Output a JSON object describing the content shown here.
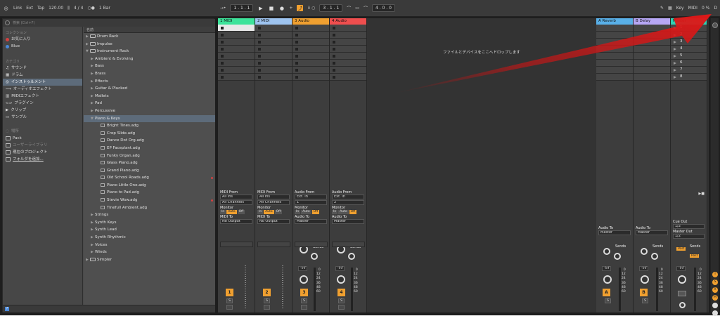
{
  "topbar": {
    "link": "Link",
    "ext": "Ext",
    "tap": "Tap",
    "tempo": "120.00",
    "meter": "4 / 4",
    "quant": "1 Bar",
    "pos1": "1 . 1 . 1",
    "pos2": "3 . 1 . 1",
    "pos3": "4 . 0 . 0",
    "key": "Key",
    "midi": "MIDI",
    "cpu": "0 %",
    "d": "D"
  },
  "browser": {
    "search_placeholder": "検索 (Ctrl+F)",
    "collections_header": "コレクション",
    "collections": [
      {
        "label": "お気に入り",
        "color": "#d24040"
      },
      {
        "label": "Blue",
        "color": "#4a88d8"
      }
    ],
    "category_header": "カテゴリ",
    "categories": [
      "サウンド",
      "ドラム",
      "インストゥルメント",
      "オーディオエフェクト",
      "MIDIエフェクト",
      "プラグイン",
      "クリップ",
      "サンプル"
    ],
    "places_header": "場所",
    "places": [
      "Pack",
      "ユーザーライブラリ",
      "現在のプロジェクト",
      "フォルダを追加..."
    ],
    "name_header": "名前",
    "items": [
      {
        "label": "Drum Rack",
        "kind": "folder-closed"
      },
      {
        "label": "Impulse",
        "kind": "folder-closed"
      },
      {
        "label": "Instrument Rack",
        "kind": "folder-open"
      },
      {
        "label": "Ambient & Evolving",
        "kind": "sub"
      },
      {
        "label": "Bass",
        "kind": "sub"
      },
      {
        "label": "Brass",
        "kind": "sub"
      },
      {
        "label": "Effects",
        "kind": "sub"
      },
      {
        "label": "Guitar & Plucked",
        "kind": "sub"
      },
      {
        "label": "Mallets",
        "kind": "sub"
      },
      {
        "label": "Pad",
        "kind": "sub"
      },
      {
        "label": "Percussive",
        "kind": "sub"
      },
      {
        "label": "Piano & Keys",
        "kind": "sub-open"
      },
      {
        "label": "Bright Tines.adg",
        "kind": "file"
      },
      {
        "label": "Crep Slide.adg",
        "kind": "file"
      },
      {
        "label": "Dance Dot Org.adg",
        "kind": "file"
      },
      {
        "label": "EP Faceplant.adg",
        "kind": "file"
      },
      {
        "label": "Funky Organ.adg",
        "kind": "file"
      },
      {
        "label": "Glass Piano.adg",
        "kind": "file"
      },
      {
        "label": "Grand Piano.adg",
        "kind": "file"
      },
      {
        "label": "Old School Roads.adg",
        "kind": "file",
        "fav": true
      },
      {
        "label": "Piano Little One.adg",
        "kind": "file"
      },
      {
        "label": "Piano to Pad.adg",
        "kind": "file"
      },
      {
        "label": "Stevie Wow.adg",
        "kind": "file",
        "fav": true
      },
      {
        "label": "Tinefull Ambient.adg",
        "kind": "file"
      },
      {
        "label": "Strings",
        "kind": "sub"
      },
      {
        "label": "Synth Keys",
        "kind": "sub"
      },
      {
        "label": "Synth Lead",
        "kind": "sub"
      },
      {
        "label": "Synth Rhythmic",
        "kind": "sub"
      },
      {
        "label": "Voices",
        "kind": "sub"
      },
      {
        "label": "Winds",
        "kind": "sub"
      },
      {
        "label": "Simpler",
        "kind": "folder-closed"
      }
    ]
  },
  "session": {
    "drop_message": "ファイルとデバイスをここへドロップします",
    "tracks": [
      {
        "name": "1 MIDI",
        "color": "#3de39a",
        "num": "1",
        "type": "midi"
      },
      {
        "name": "2 MIDI",
        "color": "#9ec4f0",
        "num": "2",
        "type": "midi"
      },
      {
        "name": "3 Audio",
        "color": "#f0a030",
        "num": "3",
        "type": "audio"
      },
      {
        "name": "4 Audio",
        "color": "#ef4e4e",
        "num": "4",
        "type": "audio"
      }
    ],
    "returns": [
      {
        "name": "A Reverb",
        "color": "#59b0e8",
        "letter": "A"
      },
      {
        "name": "B Delay",
        "color": "#b7a7f5",
        "letter": "B"
      }
    ],
    "master": {
      "name": "Master",
      "color": "#2fd2b4",
      "scenes": [
        "1",
        "2",
        "3",
        "4",
        "5",
        "6",
        "7",
        "8"
      ]
    },
    "io": {
      "midi_from": "MIDI From",
      "all_ins": "All Ins",
      "all_channels": "All Channels",
      "monitor": "Monitor",
      "in": "In",
      "auto": "Auto",
      "off": "Off",
      "midi_to": "MIDI To",
      "no_output": "No Output",
      "audio_from": "Audio From",
      "ext_in": "Ext. In",
      "ch1": "1",
      "ch2": "2",
      "audio_to": "Audio To",
      "master_out": "Master",
      "cue_out": "Cue Out",
      "cue_val": "1/2",
      "master_out_label": "Master Out",
      "master_out_val": "1/2",
      "sends": "Sends",
      "post": "Post",
      "inf": "-Inf",
      "s": "S",
      "scale": [
        "0",
        "12",
        "24",
        "36",
        "48",
        "60"
      ],
      "scale_master": [
        "0",
        "12",
        "24",
        "36",
        "48",
        "60"
      ]
    }
  }
}
